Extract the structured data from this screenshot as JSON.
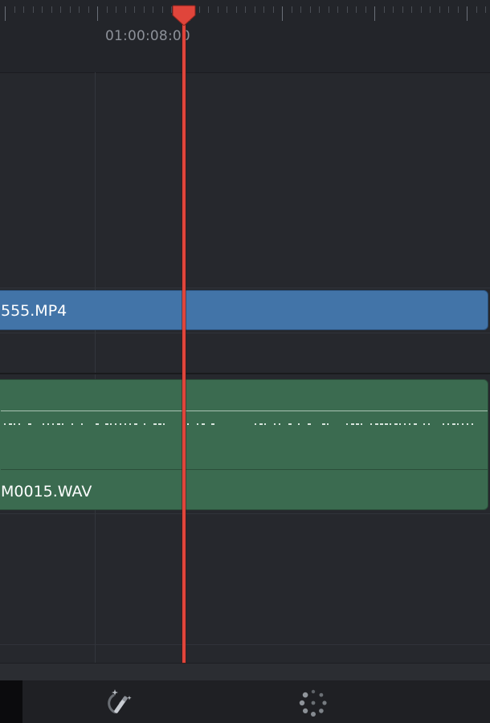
{
  "timeline": {
    "timecode_label": "01:00:08:00"
  },
  "video_track": {
    "clip_label": "555.MP4",
    "color": "#4274a8"
  },
  "audio_track": {
    "clip_label": "M0015.WAV",
    "color": "#3b6b50"
  },
  "playhead": {
    "color": "#e0453b"
  },
  "toolbar": {
    "icons": [
      "magic-wand-icon",
      "loading-spinner-icon"
    ]
  }
}
